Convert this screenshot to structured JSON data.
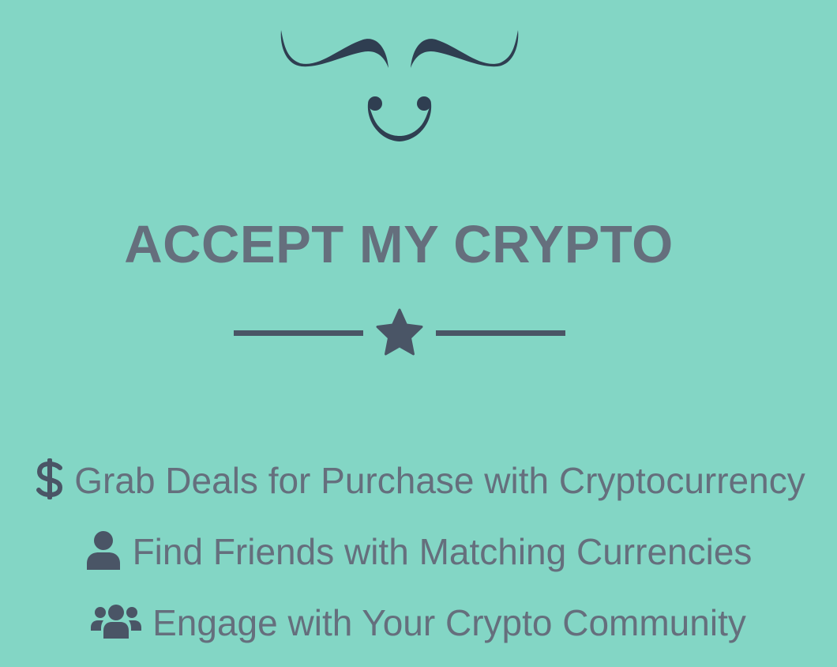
{
  "colors": {
    "background": "#83d6c5",
    "heading": "#656f7d",
    "icon": "#4a5566",
    "logo": "#2f3e51"
  },
  "logo": {
    "icon": "mustache-smile-logo"
  },
  "header": {
    "title": "ACCEPT MY CRYPTO"
  },
  "divider": {
    "icon": "star-icon"
  },
  "features": [
    {
      "icon": "dollar-sign-icon",
      "label": "Grab Deals for Purchase with Cryptocurrency"
    },
    {
      "icon": "user-icon",
      "label": "Find Friends with Matching Currencies"
    },
    {
      "icon": "users-group-icon",
      "label": "Engage with Your Crypto Community"
    }
  ]
}
